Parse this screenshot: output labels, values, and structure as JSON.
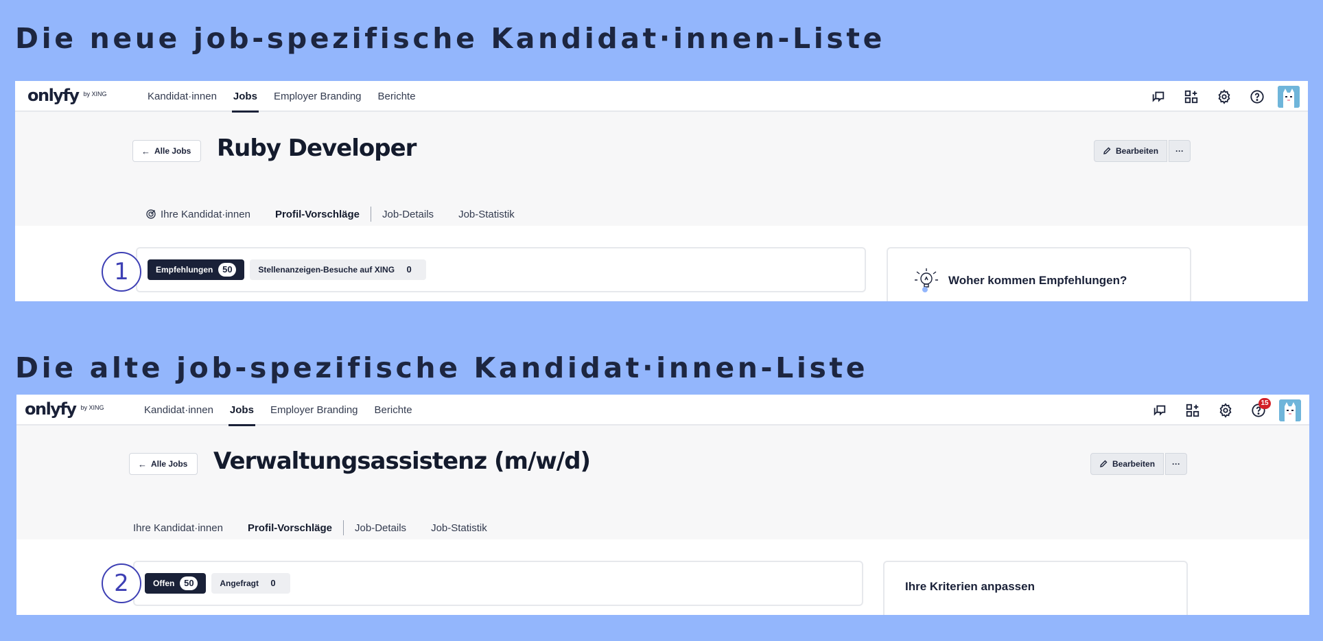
{
  "headings": {
    "new": "Die neue job-spezifische Kandidat·innen-Liste",
    "old": "Die alte job-spezifische Kandidat·innen-Liste"
  },
  "colors": {
    "page_background": "#93b6fc",
    "brand_navy": "#1a2138",
    "annotation_blue": "#3d3fb4",
    "notification_red": "#d21f27"
  },
  "new_screen": {
    "logo": {
      "main": "onlyfy",
      "byline": "by XING"
    },
    "nav": [
      {
        "label": "Kandidat·innen",
        "active": false
      },
      {
        "label": "Jobs",
        "active": true
      },
      {
        "label": "Employer Branding",
        "active": false
      },
      {
        "label": "Berichte",
        "active": false
      }
    ],
    "icons": [
      "chat-icon",
      "apps-add-icon",
      "gear-icon",
      "help-icon",
      "avatar"
    ],
    "back_label": "Alle Jobs",
    "job_title": "Ruby Developer",
    "edit_label": "Bearbeiten",
    "more_label": "···",
    "tabs": [
      {
        "label": "Ihre Kandidat·innen",
        "icon": "target-icon",
        "active": false
      },
      {
        "label": "Profil-Vorschläge",
        "active": true
      },
      {
        "label": "Job-Details",
        "active": false
      },
      {
        "label": "Job-Statistik",
        "active": false
      }
    ],
    "chips": [
      {
        "label": "Empfehlungen",
        "count": "50",
        "active": true
      },
      {
        "label": "Stellenanzeigen-Besuche auf XING",
        "count": "0",
        "active": false
      }
    ],
    "side_card_title": "Woher kommen Empfehlungen?",
    "side_card_icon": "lightbulb-icon",
    "annotation_number": "1"
  },
  "old_screen": {
    "logo": {
      "main": "onlyfy",
      "byline": "by XING"
    },
    "nav": [
      {
        "label": "Kandidat·innen",
        "active": false
      },
      {
        "label": "Jobs",
        "active": true
      },
      {
        "label": "Employer Branding",
        "active": false
      },
      {
        "label": "Berichte",
        "active": false
      }
    ],
    "icons": [
      "chat-icon",
      "apps-add-icon",
      "gear-icon",
      "help-icon",
      "avatar"
    ],
    "notification_count": "15",
    "back_label": "Alle Jobs",
    "job_title": "Verwaltungsassistenz (m/w/d)",
    "edit_label": "Bearbeiten",
    "more_label": "···",
    "tabs": [
      {
        "label": "Ihre Kandidat·innen",
        "active": false
      },
      {
        "label": "Profil-Vorschläge",
        "active": true
      },
      {
        "label": "Job-Details",
        "active": false
      },
      {
        "label": "Job-Statistik",
        "active": false
      }
    ],
    "chips": [
      {
        "label": "Offen",
        "count": "50",
        "active": true
      },
      {
        "label": "Angefragt",
        "count": "0",
        "active": false
      }
    ],
    "side_card_title": "Ihre Kriterien anpassen",
    "annotation_number": "2"
  }
}
